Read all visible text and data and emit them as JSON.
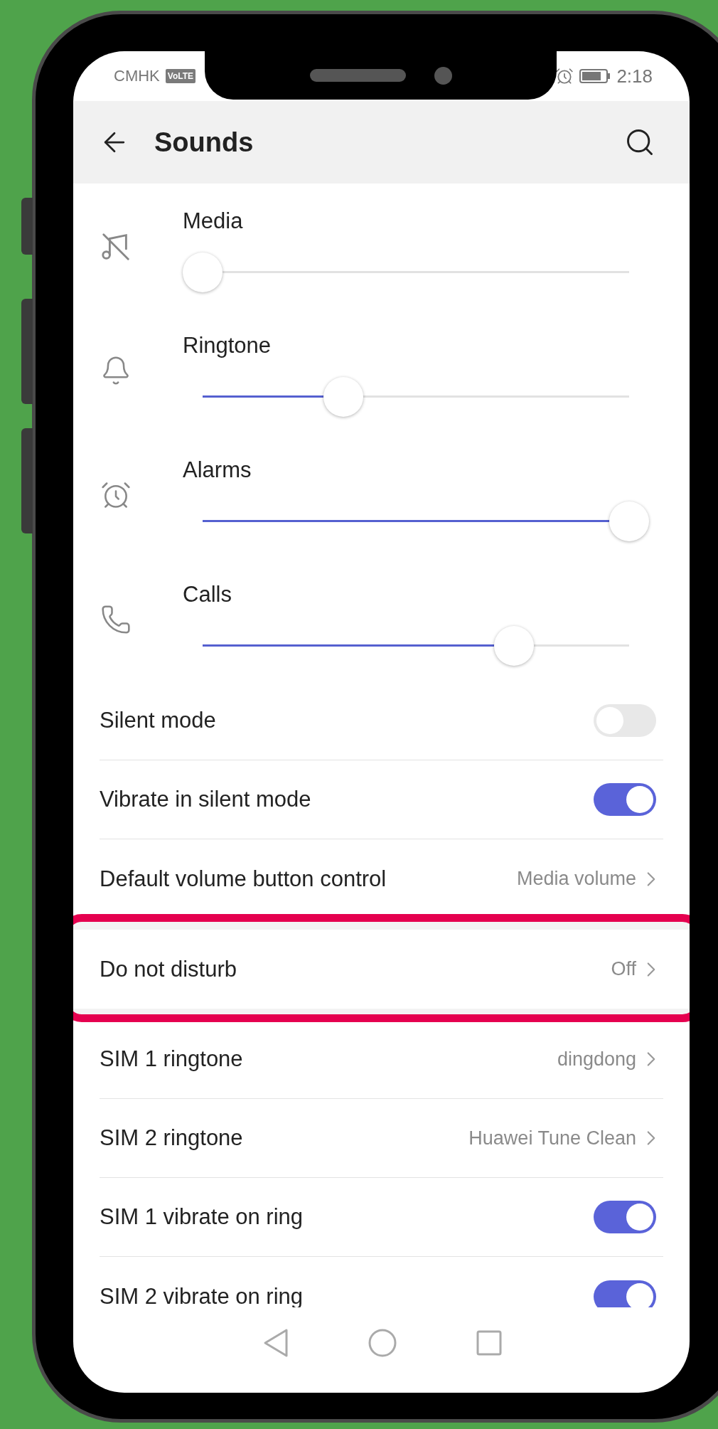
{
  "status_bar": {
    "carrier": "CMHK",
    "network_badge": "VoLTE",
    "time": "2:18"
  },
  "app_bar": {
    "title": "Sounds"
  },
  "volume_sliders": [
    {
      "kind": "media",
      "label": "Media",
      "level": 0
    },
    {
      "kind": "ringtone",
      "label": "Ringtone",
      "level": 0.33
    },
    {
      "kind": "alarm",
      "label": "Alarms",
      "level": 1
    },
    {
      "kind": "call",
      "label": "Calls",
      "level": 0.73
    }
  ],
  "setting_groups": [
    [
      {
        "kind": "toggle",
        "label": "Silent mode",
        "on": false,
        "highlighted": false
      },
      {
        "kind": "toggle",
        "label": "Vibrate in silent mode",
        "on": true,
        "highlighted": false
      },
      {
        "kind": "link",
        "label": "Default volume button control",
        "value": "Media volume",
        "highlighted": false
      }
    ],
    [
      {
        "kind": "link",
        "label": "Do not disturb",
        "value": "Off",
        "highlighted": true
      }
    ],
    [
      {
        "kind": "link",
        "label": "SIM 1 ringtone",
        "value": "dingdong",
        "highlighted": false
      },
      {
        "kind": "link",
        "label": "SIM 2 ringtone",
        "value": "Huawei Tune Clean",
        "highlighted": false
      },
      {
        "kind": "toggle",
        "label": "SIM 1 vibrate on ring",
        "on": true,
        "highlighted": false
      },
      {
        "kind": "toggle",
        "label": "SIM 2 vibrate on ring",
        "on": true,
        "highlighted": false
      }
    ]
  ]
}
